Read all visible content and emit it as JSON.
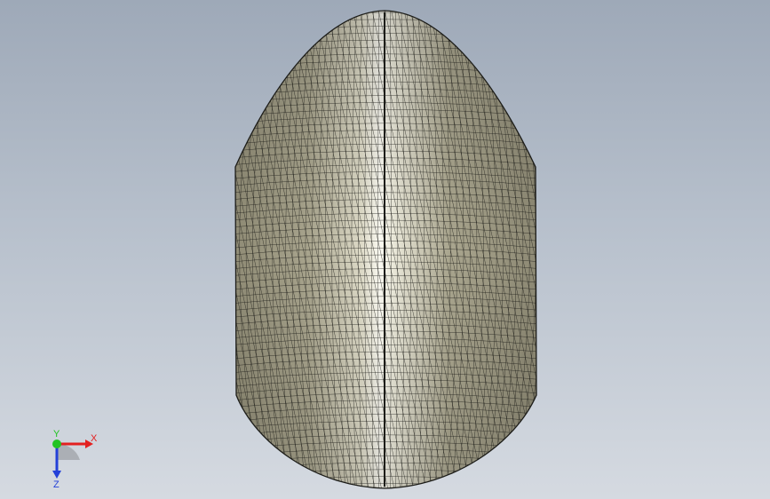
{
  "viewport": {
    "background_top": "#9ea9b8",
    "background_bottom": "#d5dae1"
  },
  "model": {
    "face_color": "#a9a58e",
    "mesh_color": "#1c1c18",
    "highlight_color": "#ffffff"
  },
  "triad": {
    "x_label": "X",
    "y_label": "Y",
    "z_label": "Z",
    "x_color": "#e32020",
    "y_color": "#22c322",
    "z_color": "#2340d8"
  }
}
